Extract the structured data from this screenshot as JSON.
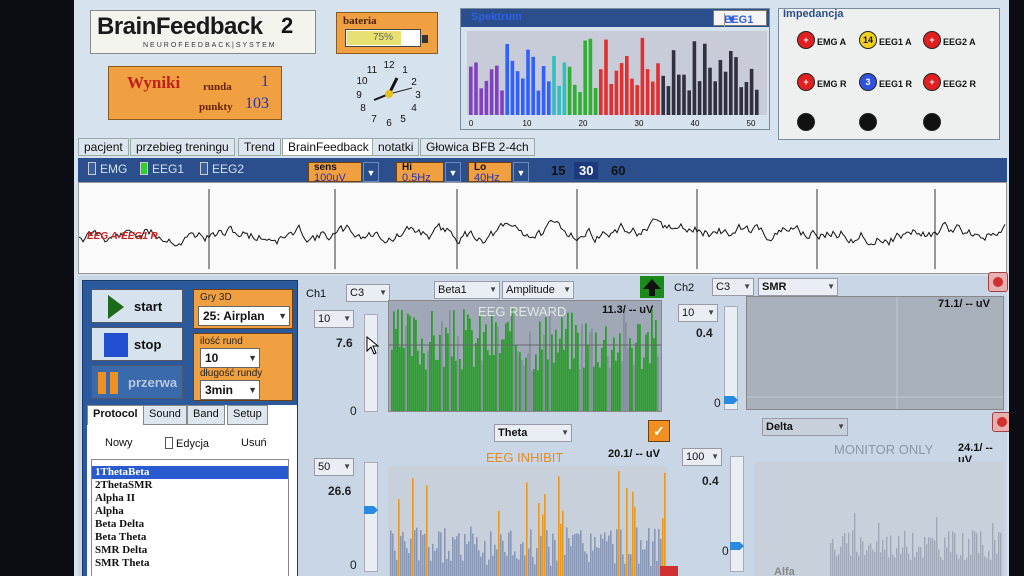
{
  "header": {
    "logo_main": "BrainFeedback",
    "logo_num": "2",
    "logo_sub": "NEUROFEEDBACK|SYSTEM",
    "battery_label": "bateria",
    "battery_pct": "75%",
    "battery_level": 0.75,
    "results_title": "Wyniki",
    "runda_label": "runda",
    "runda_value": "1",
    "punkty_label": "punkty",
    "punkty_value": "103"
  },
  "spectrum": {
    "title": "Spektrum",
    "channel": "EEG1",
    "x_ticks": [
      "0",
      "10",
      "20",
      "30",
      "40",
      "50"
    ],
    "band_colors": [
      "#8040c0",
      "#3060ff",
      "#30c0c0",
      "#30b030",
      "#e03030",
      "#303040"
    ]
  },
  "impedance": {
    "title": "Impedancja",
    "electrodes": [
      {
        "label": "EMG A",
        "value": "",
        "color": "#e02020"
      },
      {
        "label": "EEG1 A",
        "value": "14",
        "color": "#f0d020"
      },
      {
        "label": "EEG2 A",
        "value": "",
        "color": "#e02020"
      },
      {
        "label": "EMG R",
        "value": "",
        "color": "#e02020"
      },
      {
        "label": "EEG1 R",
        "value": "3",
        "color": "#3050e0"
      },
      {
        "label": "EEG2 R",
        "value": "",
        "color": "#e02020"
      },
      {
        "label": "",
        "value": "",
        "color": "#111"
      },
      {
        "label": "",
        "value": "",
        "color": "#111"
      },
      {
        "label": "",
        "value": "",
        "color": "#111"
      }
    ]
  },
  "tabs": [
    "pacjent",
    "przebieg treningu",
    "Trend",
    "BrainFeedback",
    "notatki",
    "Głowica BFB 2-4ch"
  ],
  "toolbar": {
    "emg": "EMG",
    "eeg1": "EEG1",
    "eeg2": "EEG2",
    "sens_label": "sens",
    "sens_value": "100uV",
    "hi_label": "Hi",
    "hi_value": "0.5Hz",
    "lo_label": "Lo",
    "lo_value": "40Hz",
    "times": [
      "15",
      "30",
      "60"
    ],
    "active_time": "30"
  },
  "raw": {
    "label": "EEG A-EEG1 R"
  },
  "controls": {
    "start": "start",
    "stop": "stop",
    "pause": "przerwa",
    "gry_label": "Gry 3D",
    "gry_value": "25: Airplan",
    "rounds_label": "ilość rund",
    "rounds_value": "10",
    "round_len_label": "długość rundy",
    "round_len_value": "3min"
  },
  "protocol": {
    "tabs": [
      "Protocol",
      "Sound",
      "Band",
      "Setup"
    ],
    "new": "Nowy",
    "edit": "Edycja",
    "delete": "Usuń",
    "items": [
      "1ThetaBeta",
      "2ThetaSMR",
      "Alpha II",
      "Alpha",
      "Beta Delta",
      "Beta Theta",
      "SMR Delta",
      "SMR Theta"
    ]
  },
  "ch1": {
    "label": "Ch1",
    "electrode": "C3",
    "band": "Beta1",
    "mode": "Amplitude",
    "reward_title": "EEG REWARD",
    "reward_uv": "11.3/ -- uV",
    "reward_scale": "10",
    "reward_level": "7.6",
    "reward_zero": "0",
    "inhibit_band": "Theta",
    "inhibit_title": "EEG INHIBIT",
    "inhibit_uv": "20.1/ -- uV",
    "inhibit_scale": "50",
    "inhibit_level": "26.6",
    "inhibit_zero": "0"
  },
  "ch2": {
    "label": "Ch2",
    "electrode": "C3",
    "band": "SMR",
    "uv1": "71.1/ -- uV",
    "scale1": "10",
    "level1": "0.4",
    "zero1": "0",
    "band2": "Delta",
    "monitor": "MONITOR ONLY",
    "uv2": "24.1/ -- uV",
    "scale2": "100",
    "level2": "0.4",
    "zero2": "0",
    "band3": "Alfa"
  }
}
